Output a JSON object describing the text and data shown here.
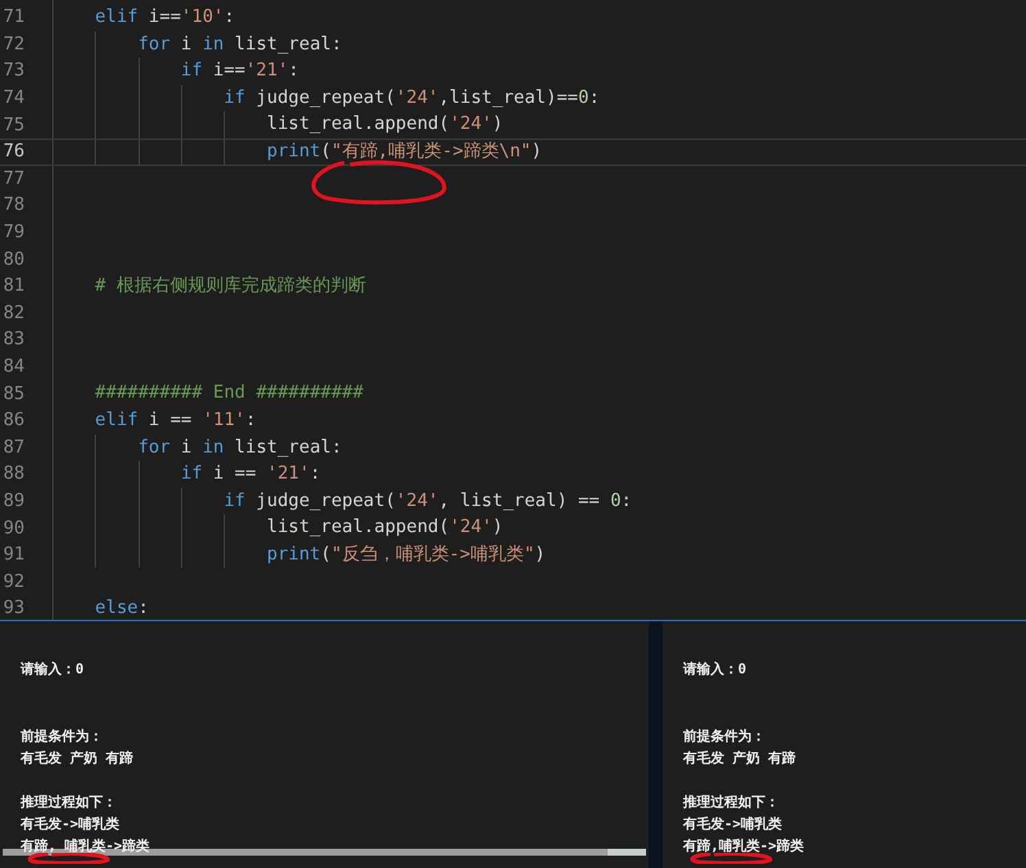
{
  "editor": {
    "lines": [
      {
        "number": "71",
        "current": false,
        "circled": false,
        "tokens": [
          {
            "text": "elif",
            "kind": "keyword"
          },
          {
            "text": " i==",
            "kind": "plain"
          },
          {
            "text": "'10'",
            "kind": "string"
          },
          {
            "text": ":",
            "kind": "plain"
          }
        ],
        "children": [
          {
            "number": "72",
            "current": false,
            "circled": false,
            "tokens": [
              {
                "text": "for",
                "kind": "keyword"
              },
              {
                "text": " i ",
                "kind": "plain"
              },
              {
                "text": "in",
                "kind": "keyword"
              },
              {
                "text": " list_real:",
                "kind": "plain"
              }
            ],
            "children": [
              {
                "number": "73",
                "current": false,
                "circled": false,
                "tokens": [
                  {
                    "text": "if",
                    "kind": "keyword"
                  },
                  {
                    "text": " i==",
                    "kind": "plain"
                  },
                  {
                    "text": "'21'",
                    "kind": "string"
                  },
                  {
                    "text": ":",
                    "kind": "plain"
                  }
                ],
                "children": [
                  {
                    "number": "74",
                    "current": false,
                    "circled": false,
                    "tokens": [
                      {
                        "text": "if",
                        "kind": "keyword"
                      },
                      {
                        "text": " judge_repeat(",
                        "kind": "plain"
                      },
                      {
                        "text": "'24'",
                        "kind": "string"
                      },
                      {
                        "text": ",list_real)==",
                        "kind": "plain"
                      },
                      {
                        "text": "0",
                        "kind": "number"
                      },
                      {
                        "text": ":",
                        "kind": "plain"
                      }
                    ],
                    "children": [
                      {
                        "number": "75",
                        "current": false,
                        "circled": false,
                        "tokens": [
                          {
                            "text": "list_real.append(",
                            "kind": "plain"
                          },
                          {
                            "text": "'24'",
                            "kind": "string"
                          },
                          {
                            "text": ")",
                            "kind": "plain"
                          }
                        ]
                      },
                      {
                        "number": "76",
                        "current": true,
                        "circled": true,
                        "tokens": [
                          {
                            "text": "print",
                            "kind": "builtin"
                          },
                          {
                            "text": "(",
                            "kind": "plain"
                          },
                          {
                            "text": "\"有蹄,哺乳类->蹄类\\n\"",
                            "kind": "string"
                          },
                          {
                            "text": ")",
                            "kind": "plain"
                          }
                        ]
                      }
                    ]
                  }
                ]
              }
            ]
          }
        ]
      },
      {
        "number": "77",
        "current": false,
        "circled": false
      },
      {
        "number": "78",
        "current": false,
        "circled": false
      },
      {
        "number": "79",
        "current": false,
        "circled": false
      },
      {
        "number": "80",
        "current": false,
        "circled": false
      },
      {
        "number": "81",
        "current": false,
        "circled": false,
        "tokens": [
          {
            "text": "# 根据右侧规则库完成蹄类的判断",
            "kind": "comment"
          }
        ]
      },
      {
        "number": "82",
        "current": false,
        "circled": false
      },
      {
        "number": "83",
        "current": false,
        "circled": false
      },
      {
        "number": "84",
        "current": false,
        "circled": false
      },
      {
        "number": "85",
        "current": false,
        "circled": false,
        "tokens": [
          {
            "text": "########## End ##########",
            "kind": "comment"
          }
        ]
      },
      {
        "number": "86",
        "current": false,
        "circled": false,
        "tokens": [
          {
            "text": "elif",
            "kind": "keyword"
          },
          {
            "text": " i == ",
            "kind": "plain"
          },
          {
            "text": "'11'",
            "kind": "string"
          },
          {
            "text": ":",
            "kind": "plain"
          }
        ],
        "children": [
          {
            "number": "87",
            "current": false,
            "circled": false,
            "tokens": [
              {
                "text": "for",
                "kind": "keyword"
              },
              {
                "text": " i ",
                "kind": "plain"
              },
              {
                "text": "in",
                "kind": "keyword"
              },
              {
                "text": " list_real:",
                "kind": "plain"
              }
            ],
            "children": [
              {
                "number": "88",
                "current": false,
                "circled": false,
                "tokens": [
                  {
                    "text": "if",
                    "kind": "keyword"
                  },
                  {
                    "text": " i == ",
                    "kind": "plain"
                  },
                  {
                    "text": "'21'",
                    "kind": "string"
                  },
                  {
                    "text": ":",
                    "kind": "plain"
                  }
                ],
                "children": [
                  {
                    "number": "89",
                    "current": false,
                    "circled": false,
                    "tokens": [
                      {
                        "text": "if",
                        "kind": "keyword"
                      },
                      {
                        "text": " judge_repeat(",
                        "kind": "plain"
                      },
                      {
                        "text": "'24'",
                        "kind": "string"
                      },
                      {
                        "text": ", list_real) == ",
                        "kind": "plain"
                      },
                      {
                        "text": "0",
                        "kind": "number"
                      },
                      {
                        "text": ":",
                        "kind": "plain"
                      }
                    ],
                    "children": [
                      {
                        "number": "90",
                        "current": false,
                        "circled": false,
                        "tokens": [
                          {
                            "text": "list_real.append(",
                            "kind": "plain"
                          },
                          {
                            "text": "'24'",
                            "kind": "string"
                          },
                          {
                            "text": ")",
                            "kind": "plain"
                          }
                        ]
                      },
                      {
                        "number": "91",
                        "current": false,
                        "circled": false,
                        "tokens": [
                          {
                            "text": "print",
                            "kind": "builtin"
                          },
                          {
                            "text": "(",
                            "kind": "plain"
                          },
                          {
                            "text": "\"反刍，哺乳类->哺乳类\"",
                            "kind": "string"
                          },
                          {
                            "text": ")",
                            "kind": "plain"
                          }
                        ]
                      }
                    ]
                  }
                ]
              }
            ]
          }
        ]
      },
      {
        "number": "92",
        "current": false,
        "circled": false
      },
      {
        "number": "93",
        "current": false,
        "circled": false,
        "tokens": [
          {
            "text": "else",
            "kind": "keyword"
          },
          {
            "text": ":",
            "kind": "plain"
          }
        ]
      }
    ]
  },
  "terminals": [
    {
      "horizontal_scrollbar": true,
      "blocks": [
        [
          {
            "text": "请输入：0",
            "circled": false
          }
        ],
        [
          {
            "text": "前提条件为：",
            "circled": false
          },
          {
            "text": "有毛发 产奶 有蹄",
            "circled": false
          }
        ],
        [
          {
            "text": "推理过程如下：",
            "circled": false
          },
          {
            "text": "有毛发->哺乳类",
            "circled": false
          },
          {
            "text": "有蹄, 哺乳类->蹄类",
            "circled": true
          }
        ]
      ]
    },
    {
      "horizontal_scrollbar": false,
      "blocks": [
        [
          {
            "text": "请输入：0",
            "circled": false
          }
        ],
        [
          {
            "text": "前提条件为：",
            "circled": false
          },
          {
            "text": "有毛发 产奶 有蹄",
            "circled": false
          }
        ],
        [
          {
            "text": "推理过程如下：",
            "circled": false
          },
          {
            "text": "有毛发->哺乳类",
            "circled": false
          },
          {
            "text": "有蹄,哺乳类->蹄类",
            "circled": true
          }
        ]
      ]
    }
  ]
}
